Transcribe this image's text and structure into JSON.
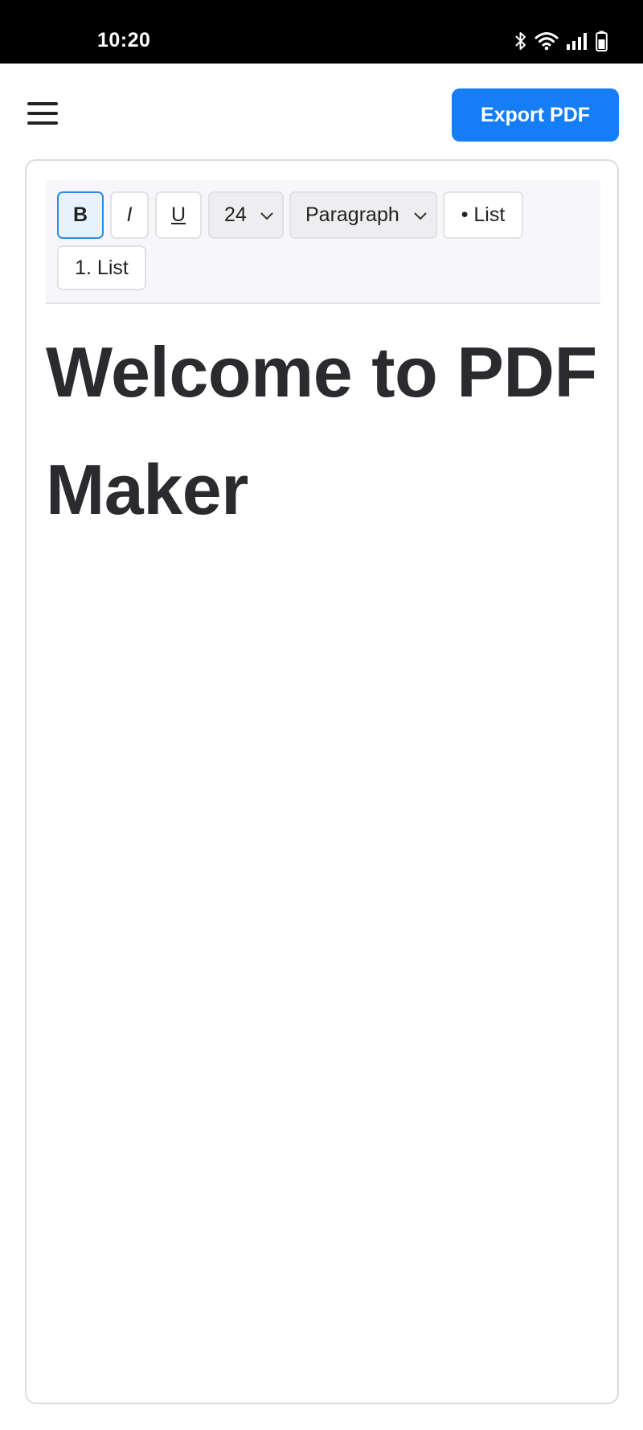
{
  "status_bar": {
    "time": "10:20",
    "icons": [
      "bluetooth-icon",
      "wifi-icon",
      "signal-icon",
      "battery-icon"
    ]
  },
  "header": {
    "menu_icon": "hamburger-menu-icon",
    "export_label": "Export PDF",
    "accent_color": "#157ef7"
  },
  "toolbar": {
    "bold_label": "B",
    "italic_label": "I",
    "underline_label": "U",
    "font_size_value": "24",
    "block_format_value": "Paragraph",
    "bullet_list_label": "• List",
    "numbered_list_label": "1. List",
    "bold_active": true
  },
  "document": {
    "heading": "Welcome to PDF Maker"
  }
}
